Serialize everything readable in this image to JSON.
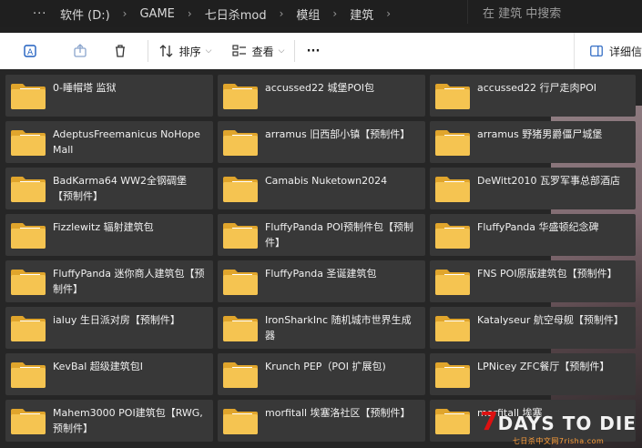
{
  "address": {
    "overflow": "···",
    "crumbs": [
      "软件 (D:)",
      "GAME",
      "七日杀mod",
      "模组",
      "建筑"
    ],
    "separator": "›",
    "search_placeholder": "在 建筑 中搜索"
  },
  "toolbar": {
    "sort_label": "排序",
    "view_label": "查看",
    "more_label": "···",
    "details_label": "详细信"
  },
  "folders": [
    "0-睡帽塔 监狱",
    "accussed22 城堡POI包",
    "accussed22 行尸走肉POI",
    "AdeptusFreemanicus NoHopeMall",
    "arramus 旧西部小镇【预制件】",
    "arramus 野猪男爵僵尸城堡",
    "BadKarma64 WW2全钢碉堡【预制件】",
    "Camabis Nuketown2024",
    "DeWitt2010 瓦罗军事总部酒店",
    "Fizzlewitz 辐射建筑包",
    "FluffyPanda POI预制件包【预制件】",
    "FluffyPanda 华盛顿纪念碑",
    "FluffyPanda 迷你商人建筑包【预制件】",
    "FluffyPanda 圣诞建筑包",
    "FNS POI原版建筑包【预制件】",
    "ialuy 生日派对房【预制件】",
    "IronSharkInc 随机城市世界生成器",
    "Katalyseur 航空母舰【预制件】",
    "KevBal 超级建筑包I",
    "Krunch PEP（POI 扩展包)",
    "LPNicey ZFC餐厅【预制件】",
    "Mahem3000 POI建筑包【RWG, 预制件】",
    "morfitall 埃塞洛社区【预制件】",
    "morfitall 埃塞"
  ],
  "watermark": {
    "seven": "7",
    "title": "DAYS TO DIE",
    "subtitle": "七日杀中文网7risha.com"
  },
  "colors": {
    "folder_body": "#f5c451",
    "folder_back": "#e0a52c",
    "tile_bg": "#383838",
    "toolbar_bg": "#ffffff"
  }
}
